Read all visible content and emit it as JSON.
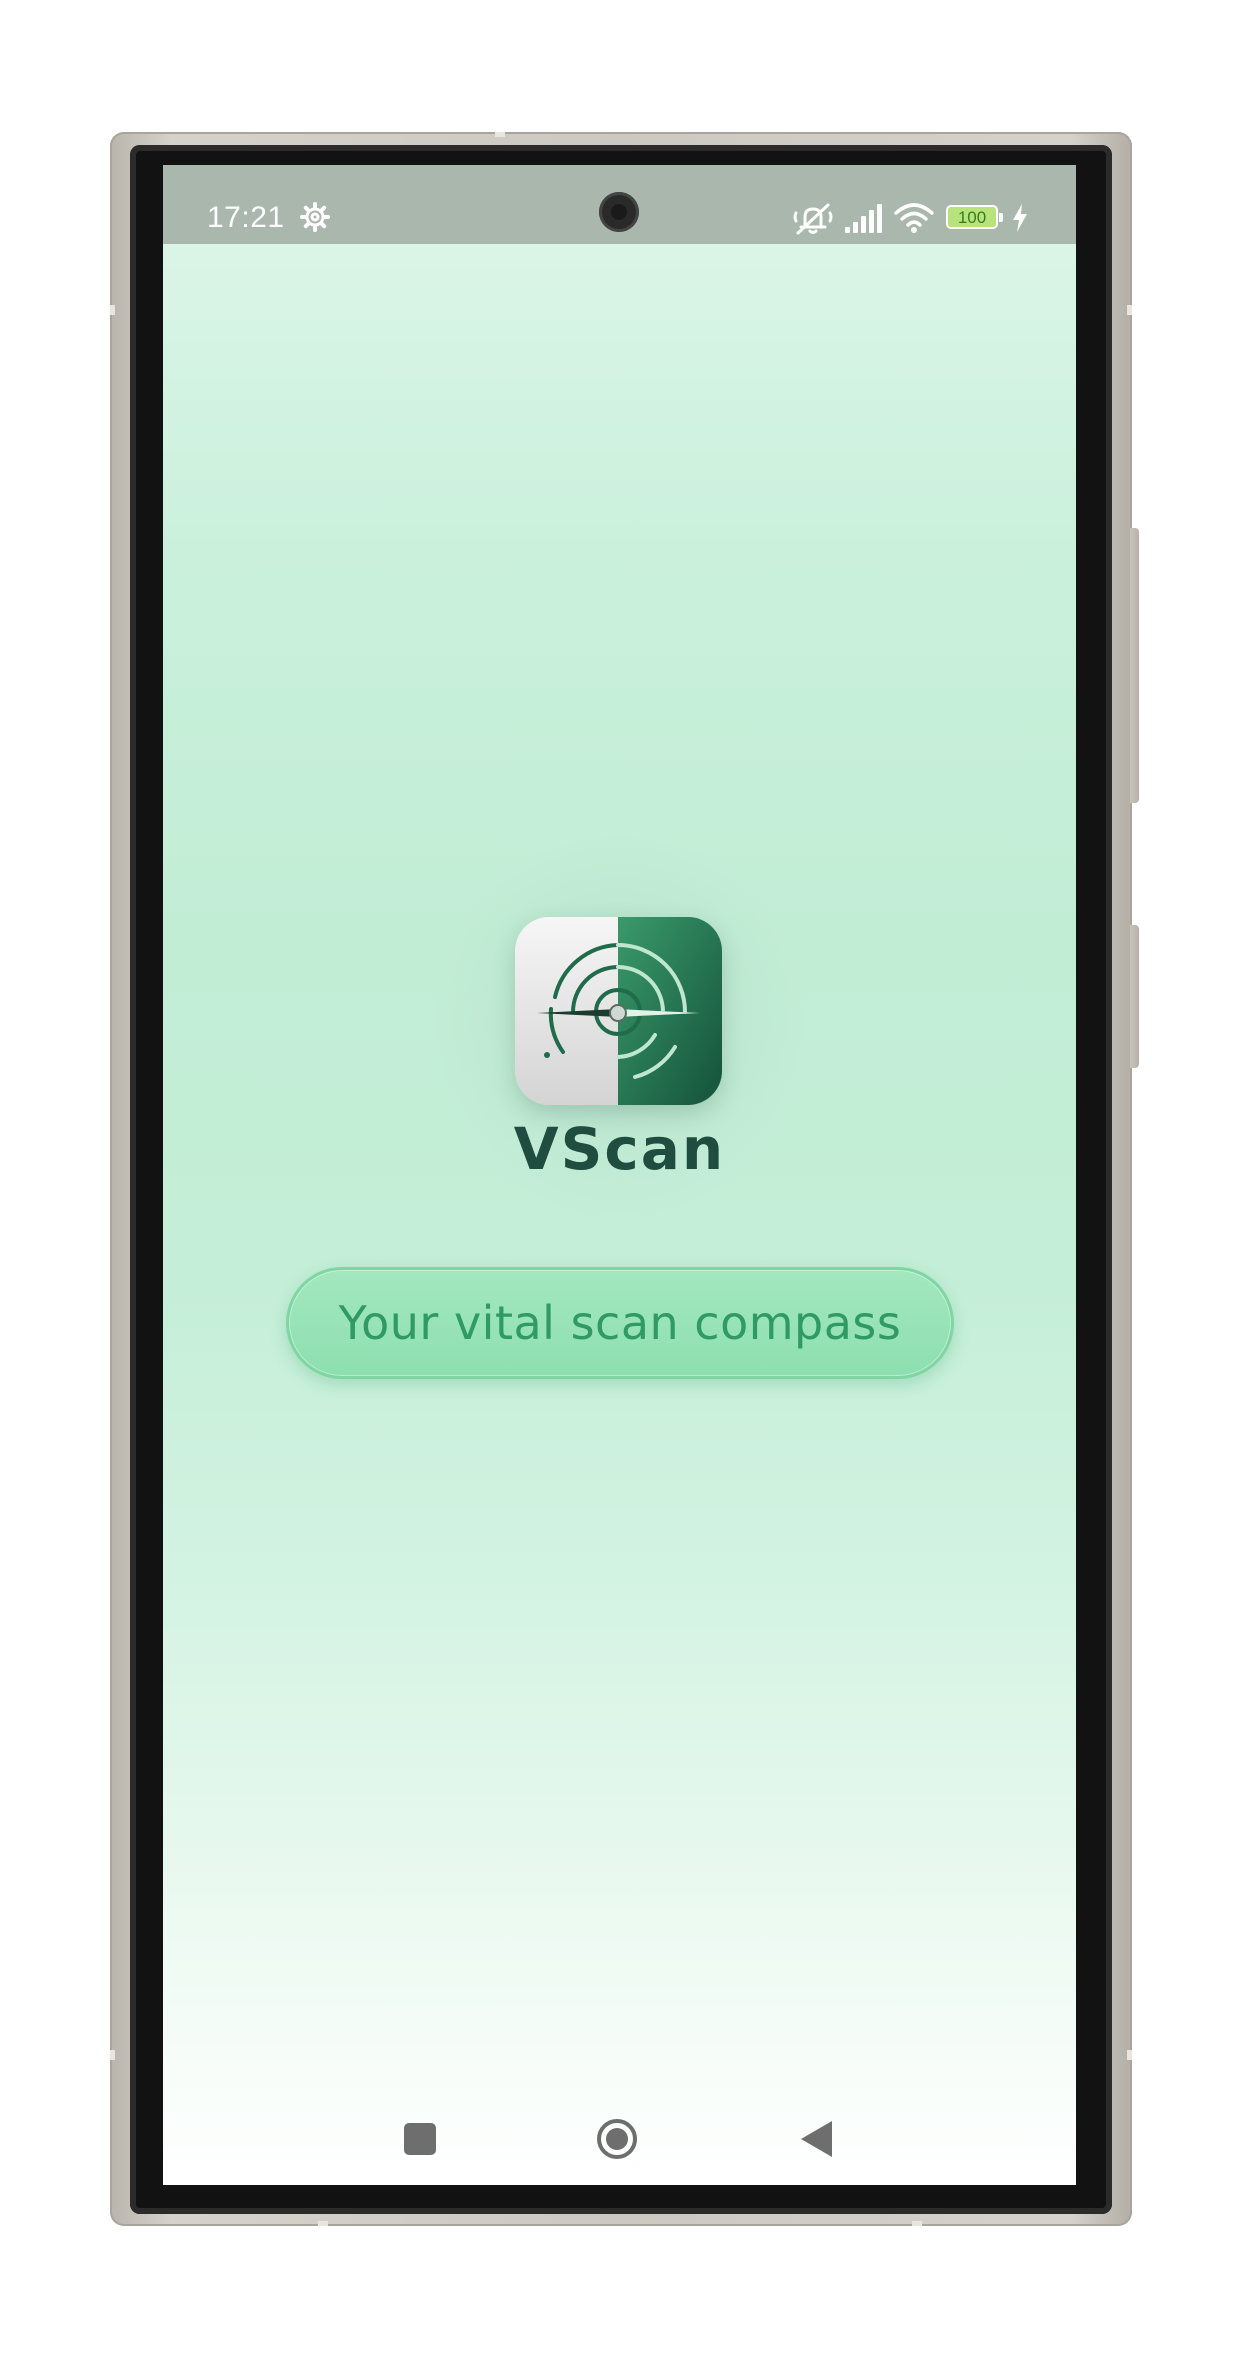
{
  "status_bar": {
    "time": "17:21",
    "battery_level": "100",
    "icons": [
      "gear-icon",
      "mute-icon",
      "signal-icon",
      "wifi-icon",
      "battery-icon",
      "charging-icon"
    ]
  },
  "splash": {
    "app_name": "VScan",
    "tagline": "Your vital scan compass",
    "logo_icon": "radar-compass-icon"
  },
  "nav_bar": {
    "buttons": [
      "recents-button",
      "home-button",
      "back-button"
    ]
  },
  "colors": {
    "status_bar_bg": "#a9b7ad",
    "screen_bg_top": "#dff6e9",
    "screen_bg_mid": "#c2edd5",
    "app_name": "#1f4d3f",
    "tagline_text": "#2f9a62",
    "tagline_pill": "#a3e7bf",
    "logo_dark_green": "#1f6b4a"
  }
}
